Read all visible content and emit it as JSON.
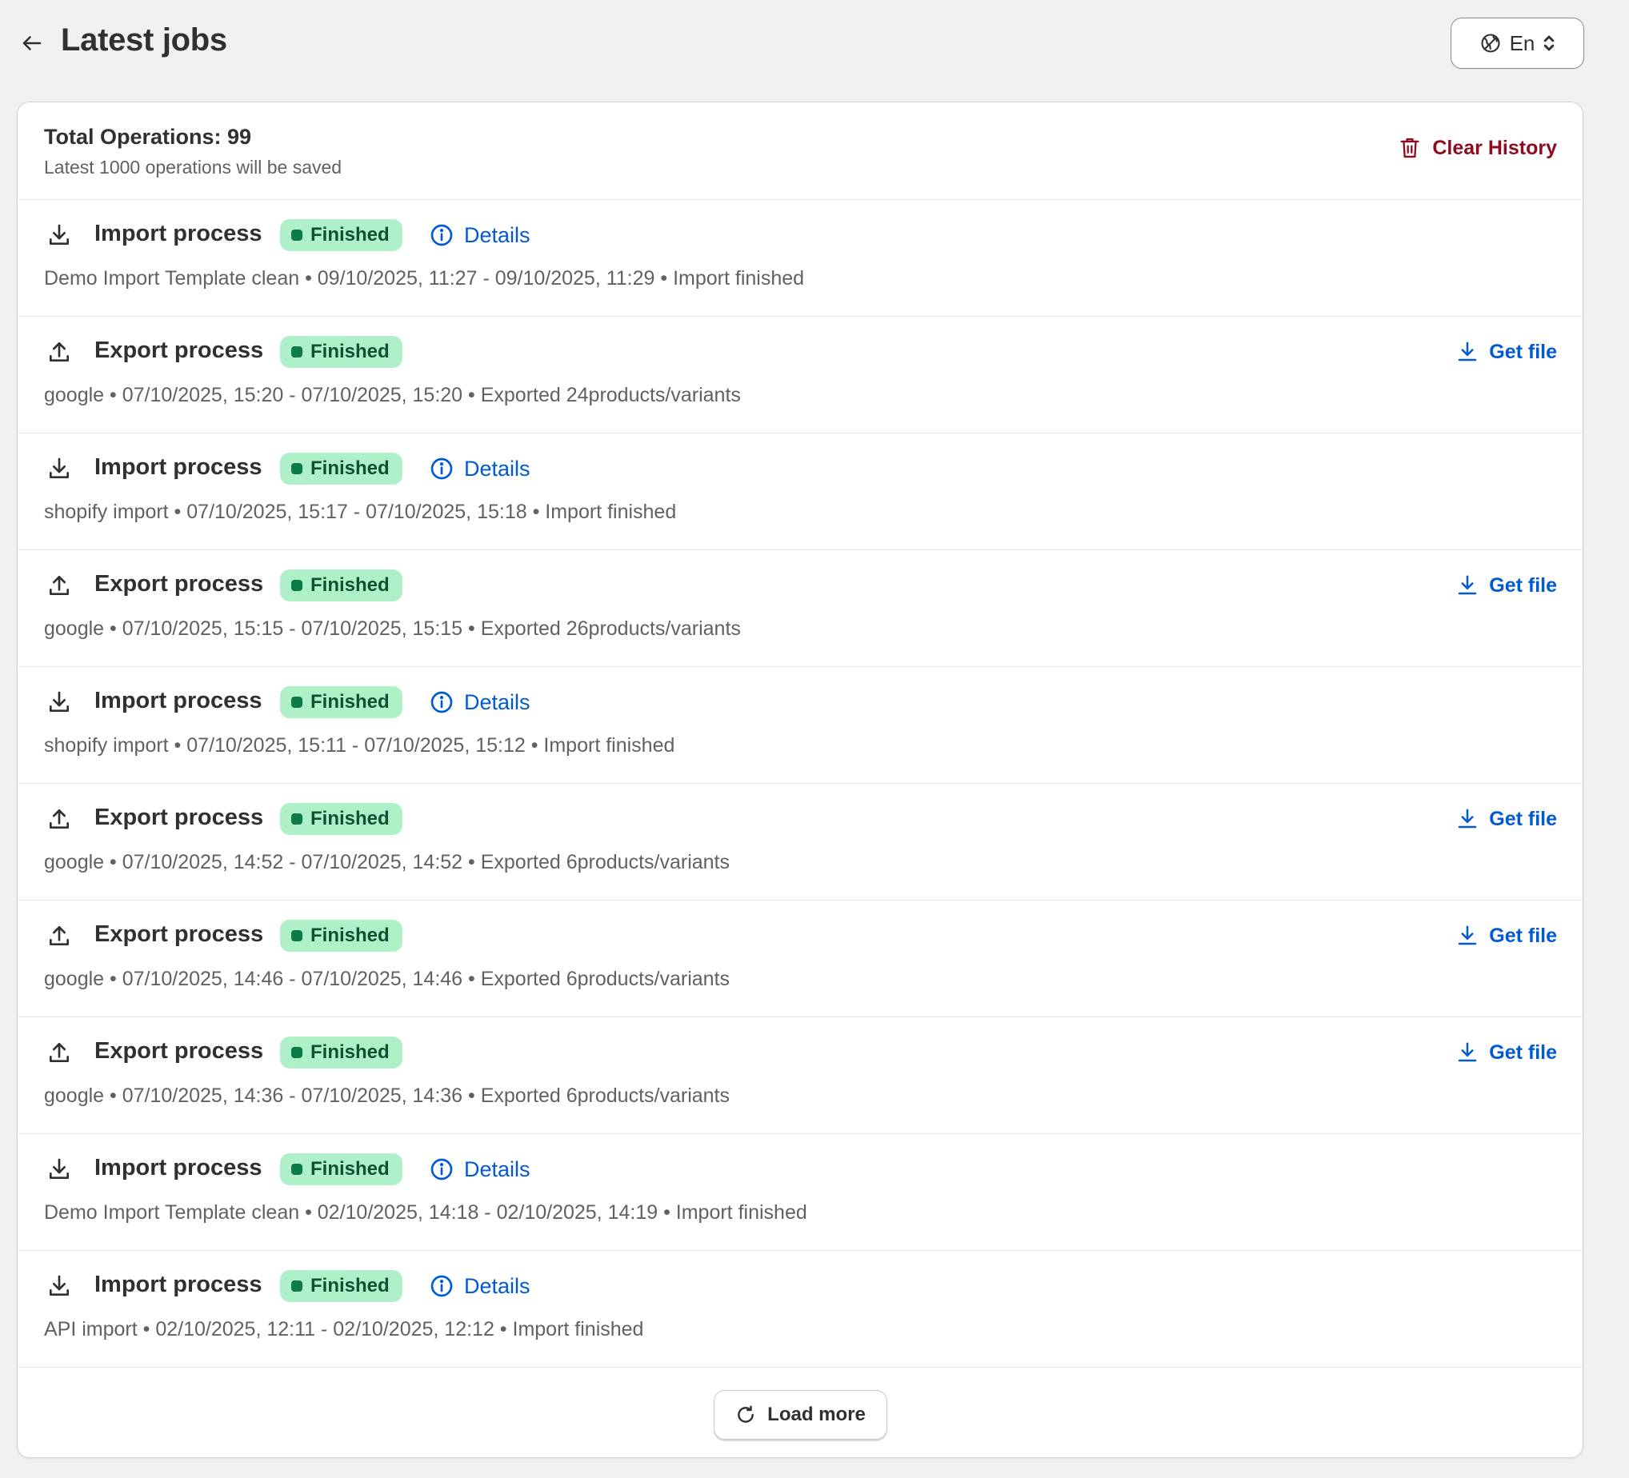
{
  "header": {
    "title": "Latest jobs",
    "language": "En"
  },
  "summary": {
    "total_label": "Total Operations: 99",
    "saved_note": "Latest 1000 operations will be saved",
    "clear_label": "Clear History"
  },
  "status_finished": "Finished",
  "details_label": "Details",
  "get_file_label": "Get file",
  "jobs": [
    {
      "kind": "import",
      "title": "Import process",
      "status": "Finished",
      "meta": "Demo Import Template clean • 09/10/2025, 11:27 - 09/10/2025, 11:29 • Import finished"
    },
    {
      "kind": "export",
      "title": "Export process",
      "status": "Finished",
      "meta": "google • 07/10/2025, 15:20 - 07/10/2025, 15:20 • Exported 24products/variants"
    },
    {
      "kind": "import",
      "title": "Import process",
      "status": "Finished",
      "meta": "shopify import • 07/10/2025, 15:17 - 07/10/2025, 15:18 • Import finished"
    },
    {
      "kind": "export",
      "title": "Export process",
      "status": "Finished",
      "meta": "google • 07/10/2025, 15:15 - 07/10/2025, 15:15 • Exported 26products/variants"
    },
    {
      "kind": "import",
      "title": "Import process",
      "status": "Finished",
      "meta": "shopify import • 07/10/2025, 15:11 - 07/10/2025, 15:12 • Import finished"
    },
    {
      "kind": "export",
      "title": "Export process",
      "status": "Finished",
      "meta": "google • 07/10/2025, 14:52 - 07/10/2025, 14:52 • Exported 6products/variants"
    },
    {
      "kind": "export",
      "title": "Export process",
      "status": "Finished",
      "meta": "google • 07/10/2025, 14:46 - 07/10/2025, 14:46 • Exported 6products/variants"
    },
    {
      "kind": "export",
      "title": "Export process",
      "status": "Finished",
      "meta": "google • 07/10/2025, 14:36 - 07/10/2025, 14:36 • Exported 6products/variants"
    },
    {
      "kind": "import",
      "title": "Import process",
      "status": "Finished",
      "meta": "Demo Import Template clean • 02/10/2025, 14:18 - 02/10/2025, 14:19 • Import finished"
    },
    {
      "kind": "import",
      "title": "Import process",
      "status": "Finished",
      "meta": "API import • 02/10/2025, 12:11 - 02/10/2025, 12:12 • Import finished"
    }
  ],
  "footer": {
    "load_more_label": "Load more"
  },
  "colors": {
    "badge_bg": "#aff0c9",
    "badge_text": "#0c5132",
    "link": "#005bd3",
    "danger": "#8e0b21"
  }
}
